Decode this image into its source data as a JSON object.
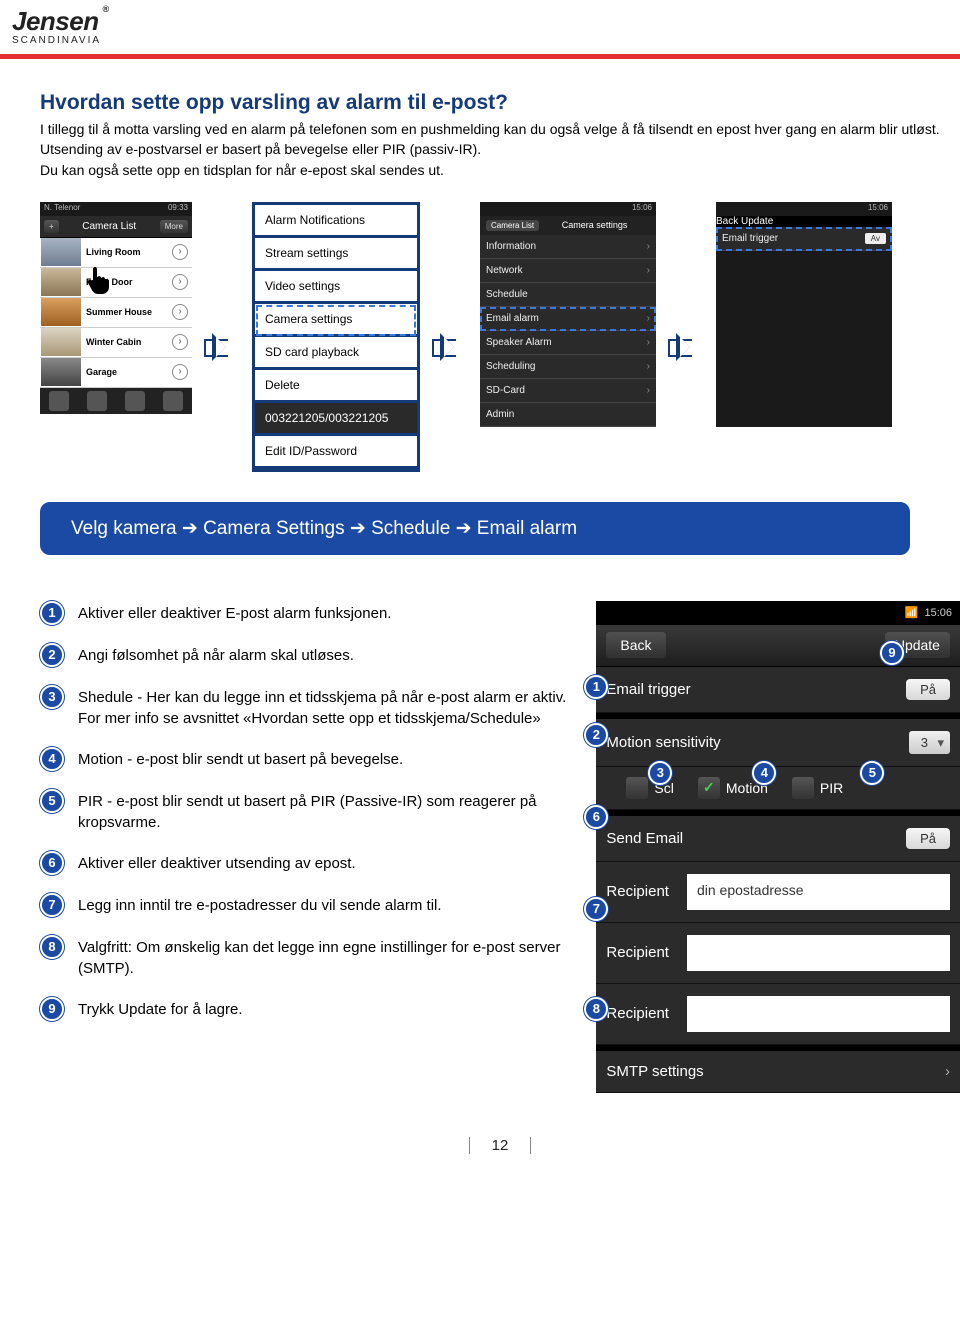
{
  "header": {
    "logo": "Jensen",
    "sub": "SCANDINAVIA"
  },
  "title": "Hvordan sette opp varsling av alarm til e-post?",
  "intro": "I tillegg til å motta varsling ved en alarm på telefonen som en pushmelding kan du også velge å få tilsendt en epost hver gang en alarm blir utløst.\nUtsending av e-postvarsel er basert på bevegelse eller PIR (passiv-IR).\nDu kan også sette opp en tidsplan for når e-epost skal sendes ut.",
  "phone1": {
    "status_left": "N. Telenor",
    "status_right": "09:33",
    "title": "Camera List",
    "more": "More",
    "cams": [
      "Living Room",
      "Front Door",
      "Summer House",
      "Winter Cabin",
      "Garage"
    ]
  },
  "menu": {
    "items": [
      "Alarm Notifications",
      "Stream settings",
      "Video settings",
      "Camera settings",
      "SD card playback",
      "Delete",
      "003221205/003221205",
      "Edit ID/Password"
    ]
  },
  "phone3": {
    "header_left": "Camera List",
    "header_right": "Camera settings",
    "rows": [
      "Information",
      "Network",
      "Schedule",
      "Email alarm",
      "Speaker Alarm",
      "Scheduling",
      "SD-Card",
      "Admin"
    ]
  },
  "phone4": {
    "back": "Back",
    "update": "Update",
    "title": "Email trigger"
  },
  "nav_text": "Velg kamera ➔ Camera Settings ➔ Schedule ➔ Email alarm",
  "steps": [
    "Aktiver eller deaktiver E-post alarm funksjonen.",
    "Angi følsomhet på når alarm skal utløses.",
    "Shedule - Her kan du legge inn et tidsskjema på når e-post alarm er aktiv. For mer info se avsnittet «Hvordan sette opp et tidsskjema/Schedule»",
    "Motion - e-post blir sendt ut basert på bevegelse.",
    "PIR - e-post blir sendt ut basert på PIR (Passive-IR) som reagerer på kropsvarme.",
    "Aktiver eller deaktiver utsending av epost.",
    "Legg inn inntil tre e-postadresser du vil sende alarm til.",
    "Valgfritt: Om ønskelig kan det legge inn egne instillinger for e-post server (SMTP).",
    "Trykk Update for å lagre."
  ],
  "big_phone": {
    "time": "15:06",
    "back": "Back",
    "update": "Update",
    "email_trigger": "Email trigger",
    "toggle_on": "På",
    "motion_sensitivity": "Motion sensitivity",
    "sens_value": "3",
    "check_sched": "Scl",
    "check_motion": "Motion",
    "check_pir": "PIR",
    "send_email": "Send Email",
    "recipient": "Recipient",
    "recipient_hint": "din epostadresse",
    "smtp": "SMTP settings"
  },
  "page_number": "12"
}
